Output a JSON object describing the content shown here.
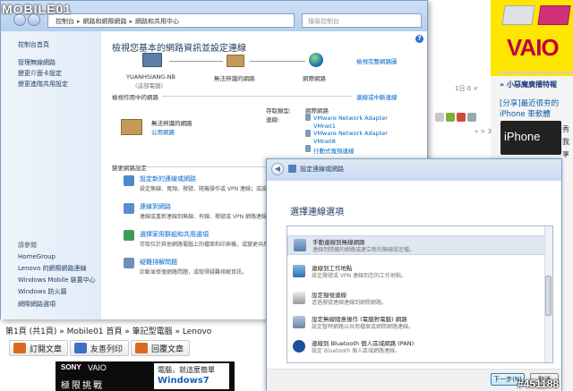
{
  "site": {
    "logo": "MOBILE01",
    "watermark": "#451188"
  },
  "forum": {
    "breadcrumb": "第1頁 (共1頁) » Mobile01 首頁 » 筆記型電腦 » Lenovo",
    "buttons": [
      {
        "label": "訂閱文章",
        "color": "#d96b1e"
      },
      {
        "label": "友善列印",
        "color": "#3b72c4"
      },
      {
        "label": "回覆文章",
        "color": "#d96b1e"
      }
    ],
    "post_date": "1日 0 ×",
    "page_nav": "« > 3",
    "ad_right": {
      "brand": "VAIO",
      "tagline": "VAIO"
    },
    "right_column": {
      "headline": "» 小惡魔廣播特報",
      "item_title": "[分享]最近很夯的iPhone 車軟體",
      "item_image_text": "iPhone",
      "item_side": "秀 我 享"
    },
    "bottom_ad": {
      "brand1": "SONY",
      "brand2": "VAIO",
      "slogan": "極限挑戰",
      "right_line1": "電腦，就這麼簡單",
      "right_line2": "Windows7"
    }
  },
  "control_panel": {
    "address": [
      "控制台",
      "網路和網際網路",
      "網路和共用中心"
    ],
    "search_placeholder": "搜尋控制台",
    "sidebar": {
      "top_links": [
        "控制台首頁",
        "管理無線網路",
        "變更介面卡設定",
        "變更進階共用設定"
      ],
      "see_also_label": "請參閱",
      "see_also": [
        "HomeGroup",
        "Lenovo 的網際網路連線",
        "Windows Mobile 裝置中心",
        "Windows 防火牆",
        "網際網路選項"
      ]
    },
    "title": "檢視您基本的網路資訊並設定連線",
    "full_map_link": "檢視完整網路圖",
    "map": {
      "computer_name": "YUANHSIANG-NB",
      "computer_sub": "(這部電腦)",
      "middle": "無法辨識的網路",
      "internet": "網際網路"
    },
    "active_label": "檢視作用中的網路",
    "connect_link": "連線或中斷連線",
    "active_network": {
      "name": "無法辨識的網路",
      "type": "公用網路",
      "access_type_label": "存取類型:",
      "access_type": "網際網路",
      "connections_label": "連線:",
      "connections": [
        "VMware Network Adapter VMnet1",
        "VMware Network Adapter VMnet8",
        "行動式寬頻連線"
      ]
    },
    "change_label": "變更網路設定",
    "tasks": [
      {
        "title": "設定新的連線或網路",
        "desc": "設定無線、寬頻、撥號、隨機操作或 VPN 連線；或設定路"
      },
      {
        "title": "連線到網路",
        "desc": "連線或重新連線到無線、有線、撥號或 VPN 網路連線。"
      },
      {
        "title": "選擇家用群組和共用選項",
        "desc": "存取位於其他網路電腦上的檔案和印表機，或變更共用設"
      },
      {
        "title": "疑難排解問題",
        "desc": "診斷並修復網路問題，或取得疑難排解資訊。"
      }
    ]
  },
  "wizard": {
    "window_title": "設定連線或網路",
    "heading": "選擇連線選項",
    "options": [
      {
        "title": "手動連線到無線網路",
        "desc": "連線到隱藏的網路或建立新的無線設定檔。",
        "selected": true
      },
      {
        "title": "連線到工作地點",
        "desc": "設定撥號或 VPN 連線到您的工作地點。",
        "selected": false
      },
      {
        "title": "設定撥號連線",
        "desc": "透過撥號連線連線到網際網路。",
        "selected": false
      },
      {
        "title": "設定無線隨意操作 (電腦對電腦) 網路",
        "desc": "設定暫時網路以共用檔案或網際網路連線。",
        "selected": false
      },
      {
        "title": "連線到 Bluetooth 個人區域網路 (PAN)",
        "desc": "設定 Bluetooth 個人區域網路連線。",
        "selected": false
      }
    ],
    "next_label": "下一步(N)",
    "cancel_label": "取消"
  }
}
